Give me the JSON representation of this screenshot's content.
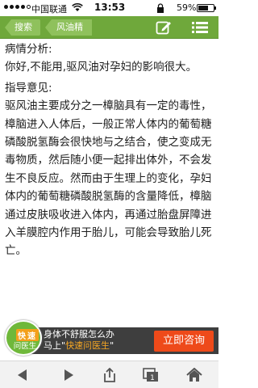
{
  "status_bar": {
    "carrier": "中国联通",
    "time": "13:53",
    "battery_pct": "59%",
    "battery_level": 0.59
  },
  "nav": {
    "search_label": "搜索",
    "crumb_label": "风油精",
    "icons": [
      "edit-icon",
      "menu-icon"
    ],
    "color": "#6fa83b"
  },
  "content": {
    "analysis_heading": "病情分析:",
    "analysis_text": "你好,不能用,驱风油对孕妇的影响很大。",
    "guidance_heading": "指导意见:",
    "guidance_text": "驱风油主要成分之一樟脑具有一定的毒性，樟脑进入人体后，一般正常人体内的葡萄糖磷酸脱氢酶会很快地与之结合，使之变成无毒物质，然后随小便一起排出体外，不会发生不良反应。然而由于生理上的变化，孕妇体内的葡萄糖磷酸脱氢酶的含量降低，樟脑通过皮肤吸收进入体内，再通过胎盘屏障进入羊膜腔内作用于胎儿，可能会导致胎儿死亡。"
  },
  "banner": {
    "badge_top": "快速",
    "badge_bottom": "问医生",
    "text_line1": "身体不舒服怎么办",
    "text_prefix": "马上\"",
    "text_highlight": "快速问医生",
    "text_suffix": "\"",
    "consult_label": "立即咨询",
    "consult_color": "#ee4a1a"
  },
  "toolbar": {
    "items": [
      "back-icon",
      "forward-icon",
      "share-icon",
      "tabs-icon",
      "home-icon"
    ],
    "tabs_count": "1"
  }
}
